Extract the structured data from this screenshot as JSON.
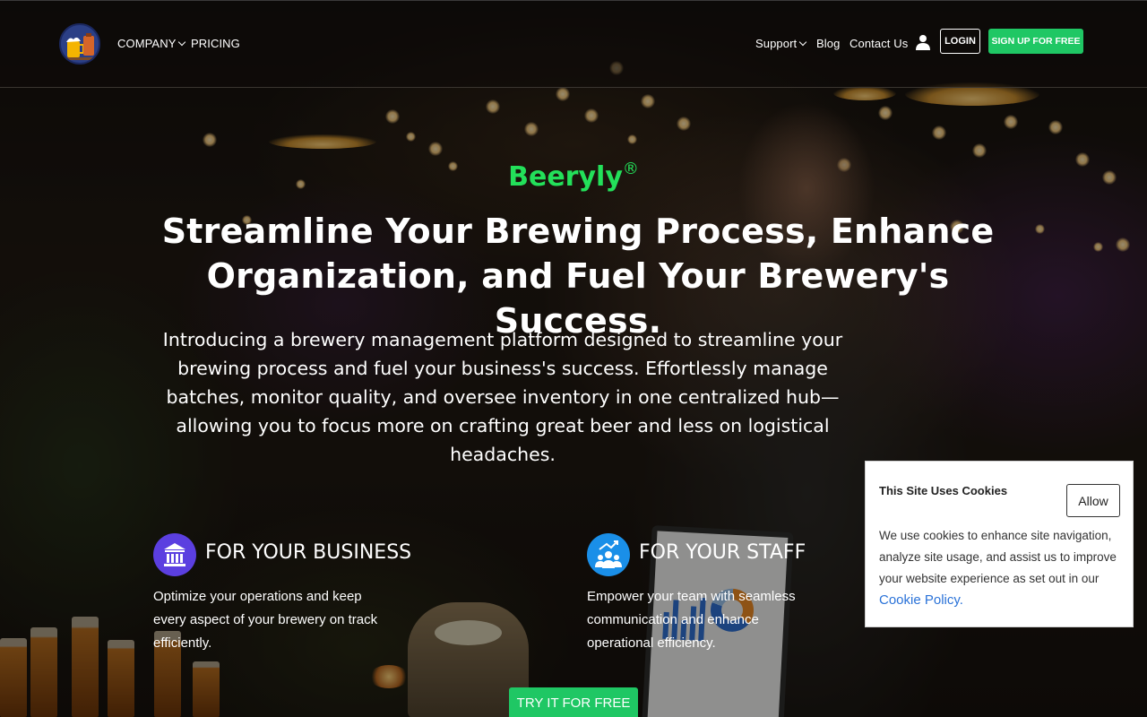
{
  "nav": {
    "logo_icon": "beer-mug-logo-icon",
    "left_links": [
      {
        "label": "COMPANY",
        "has_dropdown": true
      },
      {
        "label": "PRICING",
        "has_dropdown": false
      }
    ],
    "right_links": [
      {
        "label": "Support",
        "has_dropdown": true
      },
      {
        "label": "Blog",
        "has_dropdown": false
      },
      {
        "label": "Contact Us",
        "has_dropdown": false
      }
    ],
    "user_icon": "user-icon",
    "login_label": "LOGIN",
    "signup_label": "SIGN UP FOR FREE"
  },
  "hero": {
    "brand": "Beeryly",
    "brand_mark": "®",
    "headline": "Streamline Your Brewing Process, Enhance Organization, and Fuel Your Brewery's Success.",
    "intro": "Introducing a brewery management platform designed to streamline your brewing process and fuel your business's success. Effortlessly manage batches, monitor quality, and oversee inventory in one centralized hub—allowing you to focus more on crafting great beer and less on logistical headaches.",
    "features": [
      {
        "icon": "bank-building-icon",
        "title": "FOR YOUR BUSINESS",
        "description": "Optimize your operations and keep every aspect of your brewery on track efficiently."
      },
      {
        "icon": "team-growth-icon",
        "title": "FOR YOUR STAFF",
        "description": "Empower your team with seamless communication and enhance operational efficiency."
      }
    ],
    "cta_label": "TRY IT FOR FREE"
  },
  "cookie": {
    "title": "This Site Uses Cookies",
    "allow_label": "Allow",
    "text": "We use cookies to enhance site navigation, analyze site usage, and assist us to improve your website experience as set out in our",
    "link_label": "Cookie Policy."
  },
  "colors": {
    "accent_green": "#1fc764",
    "brand_green": "#23e05a",
    "business_icon_bg": "#5b3fe0",
    "staff_icon_bg": "#1a8fe8",
    "link_blue": "#2a72d8"
  }
}
